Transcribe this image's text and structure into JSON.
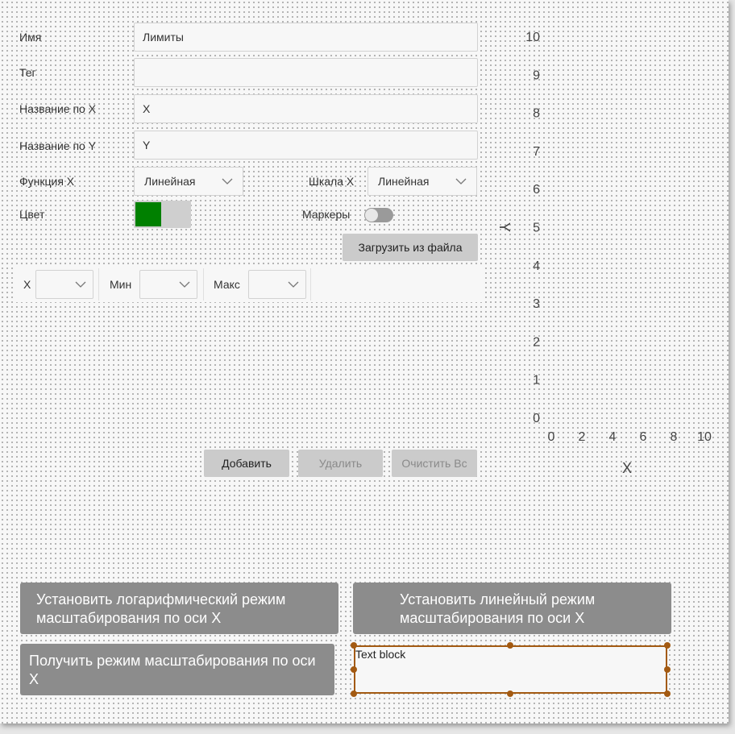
{
  "form": {
    "name_label": "Имя",
    "name_value": "Лимиты",
    "tag_label": "Тег",
    "tag_value": "",
    "x_title_label": "Название по X",
    "x_title_value": "X",
    "y_title_label": "Название по Y",
    "y_title_value": "Y",
    "x_function_label": "Функция X",
    "x_function_value": "Линейная",
    "x_scale_label": "Шкала X",
    "x_scale_value": "Линейная",
    "color_label": "Цвет",
    "color_value": "#008000",
    "markers_label": "Маркеры",
    "markers_on": false,
    "load_button": "Загрузить из файла"
  },
  "filters": {
    "x_label": "X",
    "min_label": "Мин",
    "max_label": "Макс"
  },
  "actions": {
    "add": "Добавить",
    "delete": "Удалить",
    "clear": "Очистить Вс"
  },
  "chart_data": {
    "type": "line",
    "xlabel": "X",
    "ylabel": "Y",
    "xlim": [
      0,
      10
    ],
    "ylim": [
      0,
      10
    ],
    "x_ticks": [
      "0",
      "2",
      "4",
      "6",
      "8",
      "10"
    ],
    "y_ticks": [
      "10",
      "9",
      "8",
      "7",
      "6",
      "5",
      "4",
      "3",
      "2",
      "1",
      "0"
    ],
    "series": []
  },
  "bottom": {
    "log_mode_button": "Установить логарифмический режим масштабирования по оси X",
    "linear_mode_button": "Установить линейный режим масштабирования по оси X",
    "get_mode_button": "Получить режим масштабирования по оси X",
    "text_block": "Text block"
  },
  "colors": {
    "accent_selection": "#a35a12",
    "big_button_bg": "#8c8c8c"
  }
}
